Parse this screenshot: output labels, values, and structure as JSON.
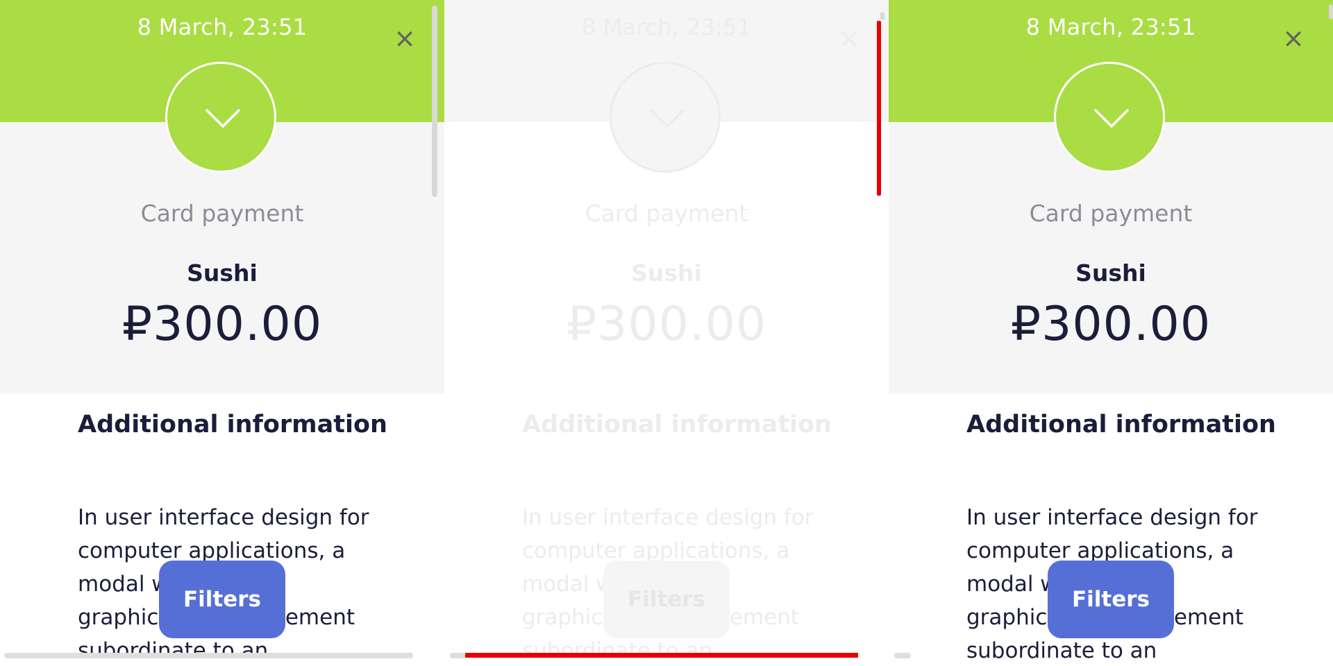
{
  "panels": [
    {
      "state": "active",
      "date": "8 March, 23:51",
      "close_label": "×",
      "status_icon": "chevron-down-icon",
      "payment_type": "Card payment",
      "merchant": "Sushi",
      "amount": "₽300.00",
      "section_title": "Additional information",
      "section_text": "In user interface design for computer applications, a modal window is a graphical control element subordinate to an",
      "filters_label": "Filters"
    },
    {
      "state": "faded",
      "date": "8 March, 23:51",
      "close_label": "×",
      "status_icon": "chevron-down-icon",
      "payment_type": "Card payment",
      "merchant": "Sushi",
      "amount": "₽300.00",
      "section_title": "Additional information",
      "section_text": "In user interface design for computer applications, a modal window is a graphical control element subordinate to an",
      "filters_label": "Filters"
    },
    {
      "state": "active",
      "date": "8 March, 23:51",
      "close_label": "×",
      "status_icon": "chevron-down-icon",
      "payment_type": "Card payment",
      "merchant": "Sushi",
      "amount": "₽300.00",
      "section_title": "Additional information",
      "section_text": "In user interface design for computer applications, a modal window is a graphical control element subordinate to an",
      "filters_label": "Filters"
    }
  ],
  "colors": {
    "accent_green": "#aadc44",
    "button_blue": "#566fd6",
    "text_dark": "#1b1d3a",
    "text_muted": "#8a8d96",
    "highlight_red": "#e60000"
  }
}
